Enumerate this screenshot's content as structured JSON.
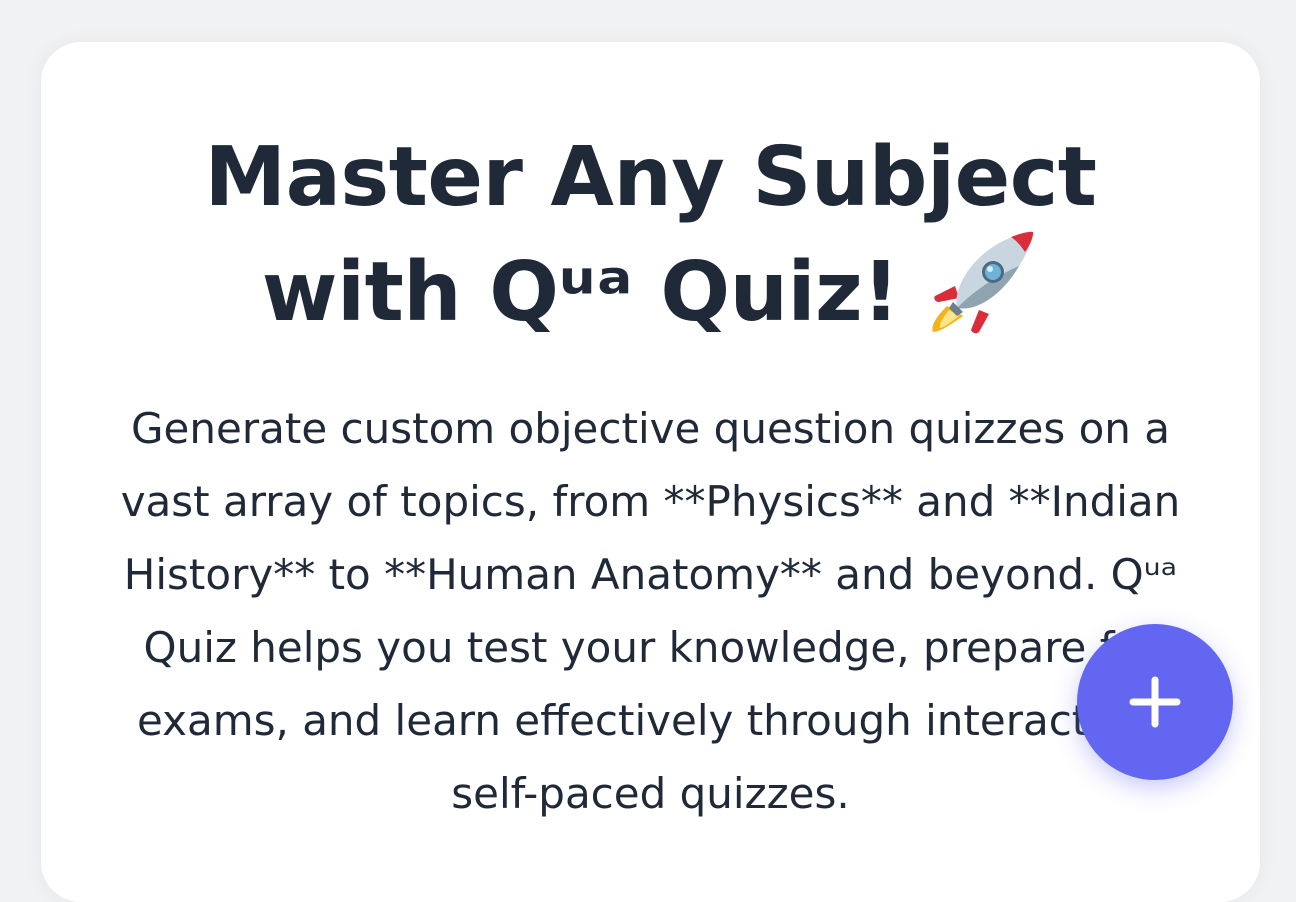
{
  "hero": {
    "title": "Master Any Subject with Qᵘᵃ Quiz!",
    "title_emoji_icon": "rocket-icon",
    "description": "Generate custom objective question quizzes on a vast array of topics, from **Physics** and **Indian History** to **Human Anatomy** and beyond. Qᵘᵃ Quiz helps you test your knowledge, prepare for exams, and learn effectively through interactive, self-paced quizzes."
  },
  "fab": {
    "icon": "plus-icon",
    "color": "#6366f1"
  },
  "colors": {
    "page_background": "#f1f2f4",
    "card_background": "#ffffff",
    "text": "#1f2937",
    "accent": "#6366f1"
  }
}
